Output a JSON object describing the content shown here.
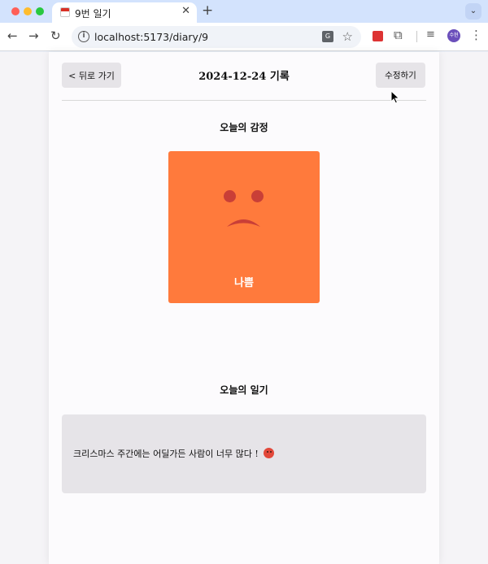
{
  "browser": {
    "tab_title": "9번 일기",
    "tab_close": "✕",
    "new_tab": "+",
    "tab_menu": "⌄",
    "url": "localhost:5173/diary/9",
    "nav_back": "←",
    "nav_forward": "→",
    "nav_reload": "↻",
    "profile_initials": "수현"
  },
  "header": {
    "back_label": "< 뒤로 가기",
    "title": "2024-12-24 기록",
    "edit_label": "수정하기"
  },
  "emotion_section": {
    "title": "오늘의 감정",
    "emotion_label": "나쁨",
    "card_color": "#ff7a3c",
    "face_color": "#c93f37"
  },
  "diary_section": {
    "title": "오늘의 일기",
    "content": "크리스마스 주간에는 어딜가든 사람이 너무 많다 !",
    "emoji": "angry-face"
  }
}
